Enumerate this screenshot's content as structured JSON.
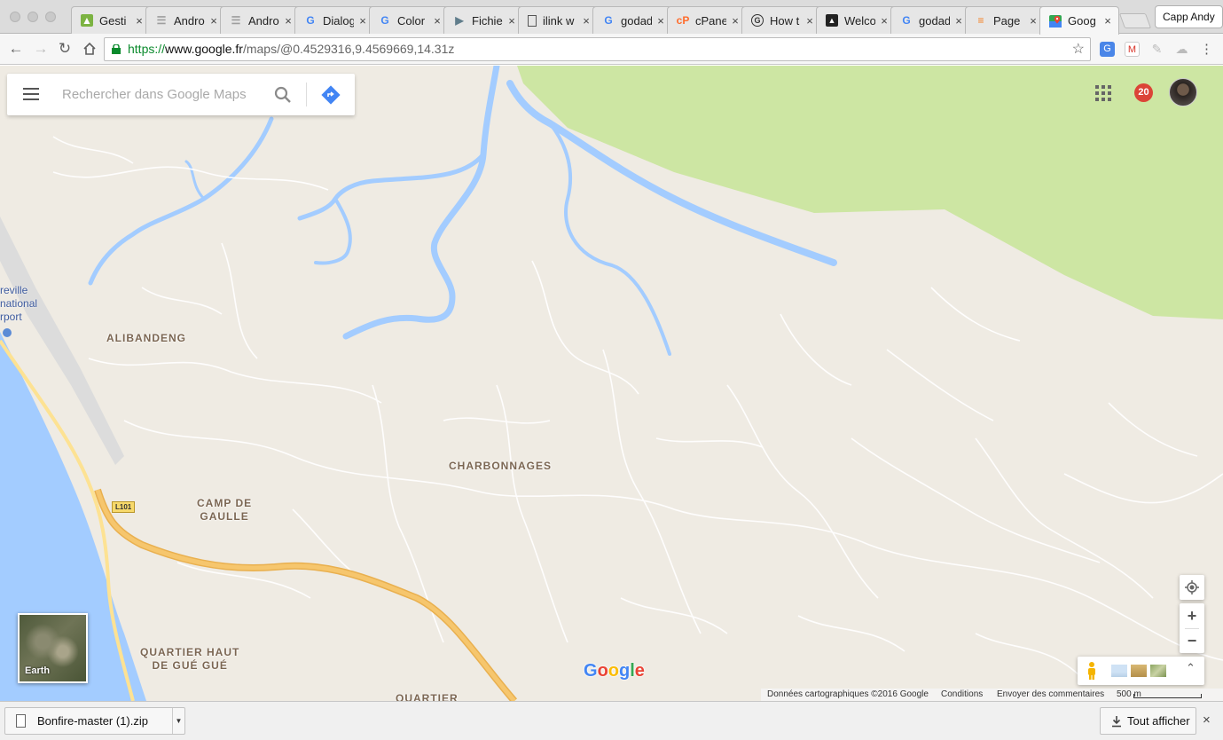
{
  "browser": {
    "tabs": [
      {
        "label": "Gesti",
        "favicon": "android-icon",
        "color": "#7cb342"
      },
      {
        "label": "Andro",
        "favicon": "list-icon",
        "color": "#9e9e9e"
      },
      {
        "label": "Andro",
        "favicon": "list-icon",
        "color": "#9e9e9e"
      },
      {
        "label": "Dialog",
        "favicon": "google-icon",
        "color": "#4285f4"
      },
      {
        "label": "Color",
        "favicon": "google-icon",
        "color": "#4285f4"
      },
      {
        "label": "Fichie",
        "favicon": "play-icon",
        "color": "#607d8b"
      },
      {
        "label": "ilink w",
        "favicon": "page-icon",
        "color": "#555555"
      },
      {
        "label": "godad",
        "favicon": "google-icon",
        "color": "#4285f4"
      },
      {
        "label": "cPanel",
        "favicon": "cpanel-icon",
        "color": "#ff6c2c"
      },
      {
        "label": "How t",
        "favicon": "circle-g-icon",
        "color": "#333333"
      },
      {
        "label": "Welco",
        "favicon": "flame-icon",
        "color": "#222222"
      },
      {
        "label": "godad",
        "favicon": "google-icon",
        "color": "#4285f4"
      },
      {
        "label": "Page",
        "favicon": "stack-icon",
        "color": "#f48024"
      },
      {
        "label": "Goog",
        "favicon": "maps-icon",
        "color": "#34a853",
        "active": true
      }
    ],
    "close_glyph": "×",
    "profile_name": "Capp Andy",
    "url": {
      "scheme": "https://",
      "host": "www.google.fr",
      "path": "/maps/@0.4529316,9.4569669,14.31z"
    }
  },
  "maps": {
    "search_placeholder": "Rechercher dans Google Maps",
    "notification_count": "20",
    "places": [
      {
        "name": "ALIBANDENG"
      },
      {
        "name": "CHARBONNAGES"
      },
      {
        "name": "CAMP DE\nGAULLE"
      },
      {
        "name": "QUARTIER HAUT\nDE GUÉ GUÉ"
      },
      {
        "name": "QUARTIER"
      }
    ],
    "airport_label": "reville\nnational\nrport",
    "road_badge": "L101",
    "earth_label": "Earth",
    "zoom_in": "+",
    "zoom_out": "−",
    "logo": "Google",
    "footer": {
      "map_data": "Données cartographiques ©2016 Google",
      "terms": "Conditions",
      "feedback": "Envoyer des commentaires",
      "scale": "500 m"
    },
    "colors": {
      "land": "#efebe3",
      "water": "#a3ccff",
      "park": "#cde6a3",
      "highway": "#f6c66d"
    }
  },
  "downloads": {
    "file_name": "Bonfire-master (1).zip",
    "show_all": "Tout afficher",
    "close_glyph": "×"
  }
}
